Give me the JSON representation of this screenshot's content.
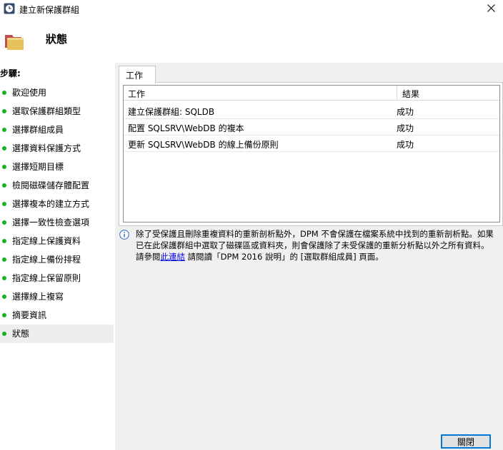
{
  "window": {
    "title": "建立新保護群組",
    "icon": "clock-icon",
    "close_icon": "close-icon"
  },
  "header": {
    "title": "狀態",
    "icon": "folder-icon"
  },
  "sidebar": {
    "label": "步驟:",
    "steps": [
      {
        "label": "歡迎使用"
      },
      {
        "label": "選取保護群組類型"
      },
      {
        "label": "選擇群組成員"
      },
      {
        "label": "選擇資料保護方式"
      },
      {
        "label": "選擇短期目標"
      },
      {
        "label": "檢閱磁碟儲存體配置"
      },
      {
        "label": "選擇複本的建立方式"
      },
      {
        "label": "選擇一致性檢查選項"
      },
      {
        "label": "指定線上保護資料"
      },
      {
        "label": "指定線上備份排程"
      },
      {
        "label": "指定線上保留原則"
      },
      {
        "label": "選擇線上複寫"
      },
      {
        "label": "摘要資訊"
      },
      {
        "label": "狀態"
      }
    ],
    "current_step": "狀態",
    "step_indicator_color": "#17b21f"
  },
  "main": {
    "tab_label": "工作",
    "grid": {
      "columns": [
        "工作",
        "結果"
      ],
      "rows": [
        {
          "task": "建立保護群組: SQLDB",
          "result": "成功"
        },
        {
          "task": "配置 SQLSRV\\WebDB 的複本",
          "result": "成功"
        },
        {
          "task": "更新 SQLSRV\\WebDB 的線上備份原則",
          "result": "成功"
        }
      ]
    },
    "info": {
      "icon": "info-icon",
      "line1": "除了受保護且刪除重複資料的重新剖析點外，DPM 不會保護在檔案系統中找到的重新剖析點。如果已在此保護群組中選取了磁碟區或資料夾，則會保護除了未受保護的重新分析點以外之所有資料。",
      "line2_prefix": "請參閱",
      "link_text": "此連結",
      "line2_suffix": " 請閱讀「DPM 2016 說明」的 [選取群組成員] 頁面。"
    },
    "close_button_label": "關閉"
  }
}
